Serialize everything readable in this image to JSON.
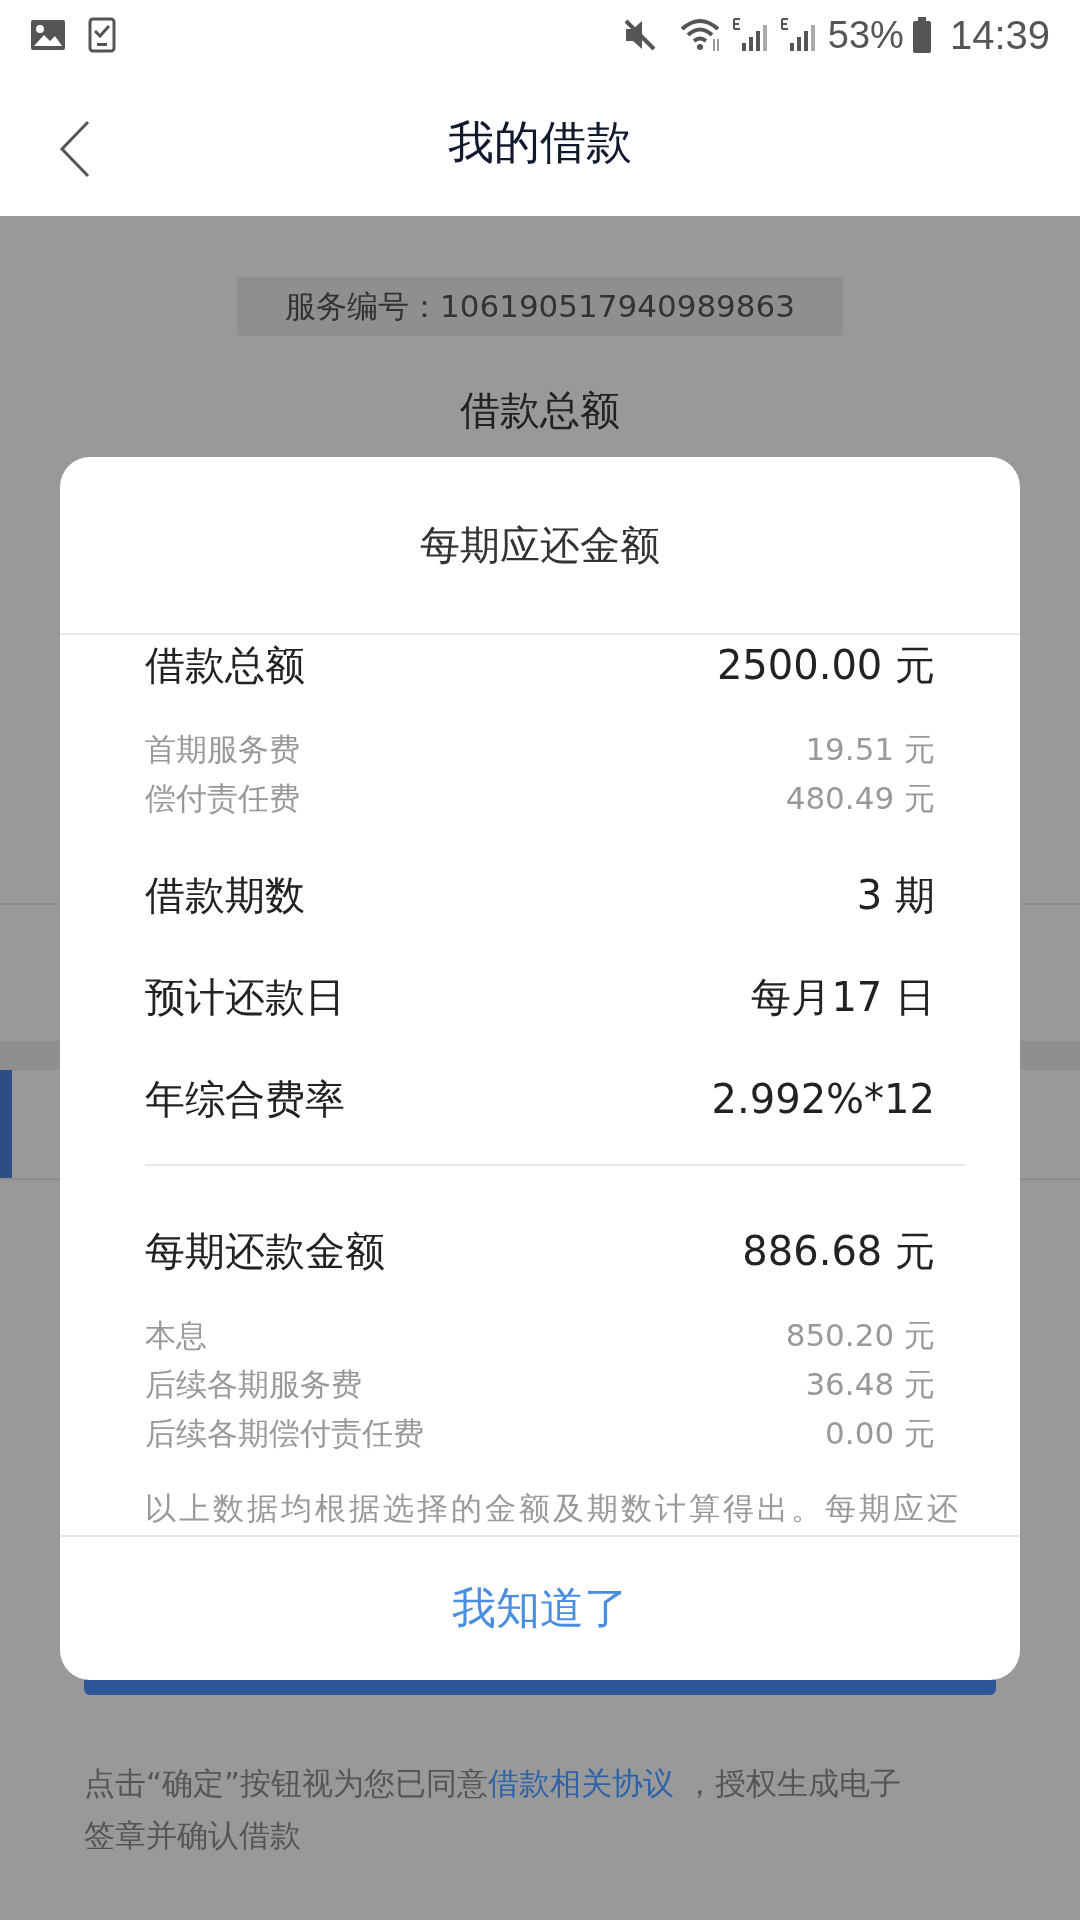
{
  "status_bar": {
    "battery": "53%",
    "time": "14:39"
  },
  "nav": {
    "title": "我的借款"
  },
  "background": {
    "service_number": "服务编号：106190517940989863",
    "section_label": "借款总额",
    "agreement": {
      "before": "点击“确定”按钮视为您已同意",
      "link": "借款相关协议",
      "after": " ，授权生成电子签章并确认借款"
    }
  },
  "dialog": {
    "title": "每期应还金额",
    "groups": [
      {
        "rows": [
          {
            "kind": "major",
            "label": "借款总额",
            "value": "2500.00 元"
          },
          {
            "kind": "minor",
            "label": "首期服务费",
            "value": "19.51 元"
          },
          {
            "kind": "minor",
            "label": "偿付责任费",
            "value": "480.49 元"
          },
          {
            "kind": "major",
            "label": "借款期数",
            "value": "3 期"
          },
          {
            "kind": "major",
            "label": "预计还款日",
            "value": "每月17 日"
          },
          {
            "kind": "major",
            "label": "年综合费率",
            "value": "2.992%*12"
          }
        ]
      },
      {
        "rows": [
          {
            "kind": "major",
            "label": "每期还款金额",
            "value": "886.68 元"
          },
          {
            "kind": "minor",
            "label": "本息",
            "value": "850.20 元"
          },
          {
            "kind": "minor",
            "label": "后续各期服务费",
            "value": "36.48 元"
          },
          {
            "kind": "minor",
            "label": "后续各期偿付责任费",
            "value": "0.00 元"
          }
        ]
      }
    ],
    "note": "以上数据均根据选择的金额及期数计算得出。每期应还",
    "button": "我知道了"
  }
}
